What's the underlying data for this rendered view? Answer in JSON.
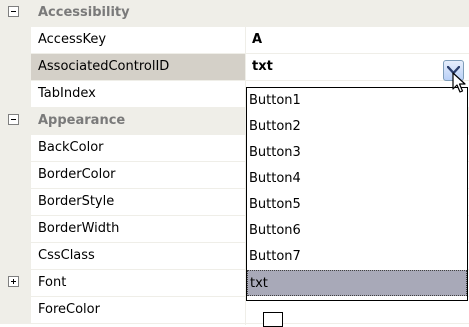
{
  "grid": {
    "categories": {
      "accessibility": "Accessibility",
      "appearance": "Appearance"
    },
    "properties": {
      "access_key": {
        "name": "AccessKey",
        "value": "A"
      },
      "associated_control_id": {
        "name": "AssociatedControlID",
        "value": "txt"
      },
      "tab_index": {
        "name": "TabIndex"
      },
      "back_color": {
        "name": "BackColor"
      },
      "border_color": {
        "name": "BorderColor"
      },
      "border_style": {
        "name": "BorderStyle"
      },
      "border_width": {
        "name": "BorderWidth"
      },
      "css_class": {
        "name": "CssClass"
      },
      "font": {
        "name": "Font"
      },
      "fore_color": {
        "name": "ForeColor"
      }
    }
  },
  "dropdown": {
    "options": [
      "Button1",
      "Button2",
      "Button3",
      "Button4",
      "Button5",
      "Button6",
      "Button7",
      "txt"
    ],
    "selected": "txt"
  },
  "colors": {
    "category_bg": "#efeee8",
    "selection_bg": "#a8a9b8"
  },
  "icons": {
    "collapse": "minus-square-icon",
    "expand": "plus-square-icon",
    "dropdown": "chevron-down-icon",
    "cursor": "mouse-pointer-icon"
  }
}
